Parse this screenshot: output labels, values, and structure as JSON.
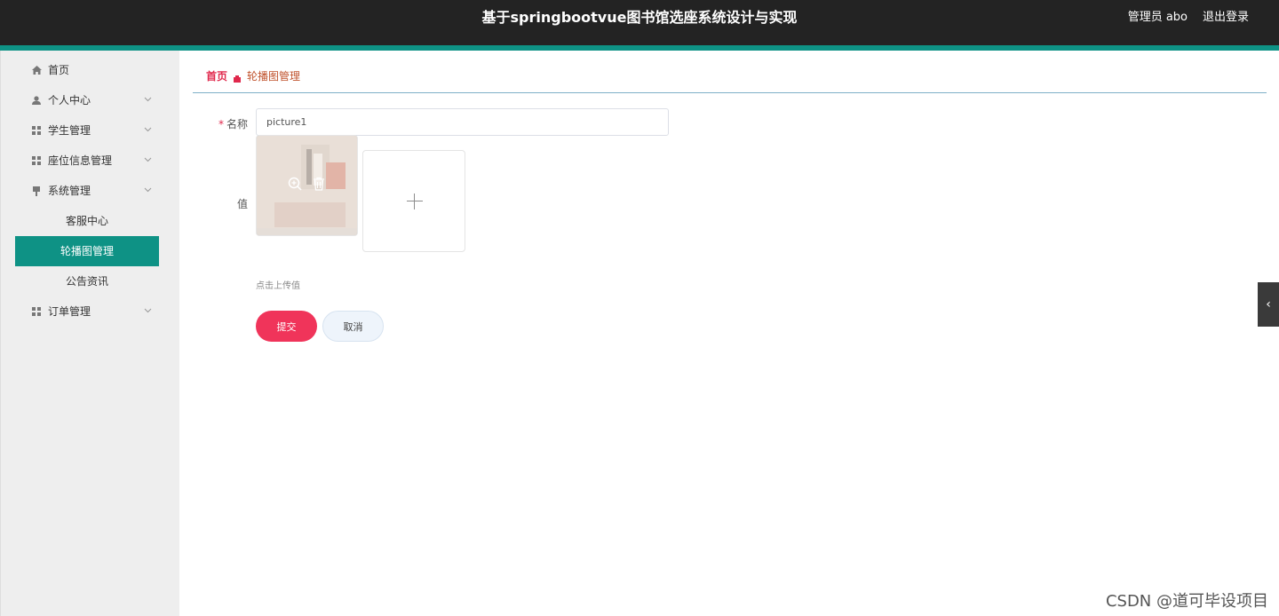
{
  "header": {
    "title": "基于springbootvue图书馆选座系统设计与实现",
    "user": "管理员 abo",
    "logout": "退出登录",
    "accent_color": "#0e9285",
    "bg_color": "#232323"
  },
  "sidebar": {
    "items": [
      {
        "label": "首页",
        "icon": "home-icon",
        "expandable": false
      },
      {
        "label": "个人中心",
        "icon": "user-icon",
        "expandable": true
      },
      {
        "label": "学生管理",
        "icon": "grid-icon",
        "expandable": true
      },
      {
        "label": "座位信息管理",
        "icon": "grid-icon",
        "expandable": true
      },
      {
        "label": "系统管理",
        "icon": "pin-icon",
        "expandable": true
      },
      {
        "label": "订单管理",
        "icon": "grid-icon",
        "expandable": true
      }
    ],
    "system_subitems": [
      {
        "label": "客服中心",
        "active": false
      },
      {
        "label": "轮播图管理",
        "active": true
      },
      {
        "label": "公告资讯",
        "active": false
      }
    ],
    "active_color": "#0e9285"
  },
  "breadcrumb": {
    "home": "首页",
    "current": "轮播图管理"
  },
  "form": {
    "name_label": "名称",
    "name_value": "picture1",
    "value_label": "值",
    "upload_hint": "点击上传值",
    "submit": "提交",
    "cancel": "取消",
    "submit_color": "#f0345a"
  },
  "watermark": "CSDN @道可毕设项目"
}
